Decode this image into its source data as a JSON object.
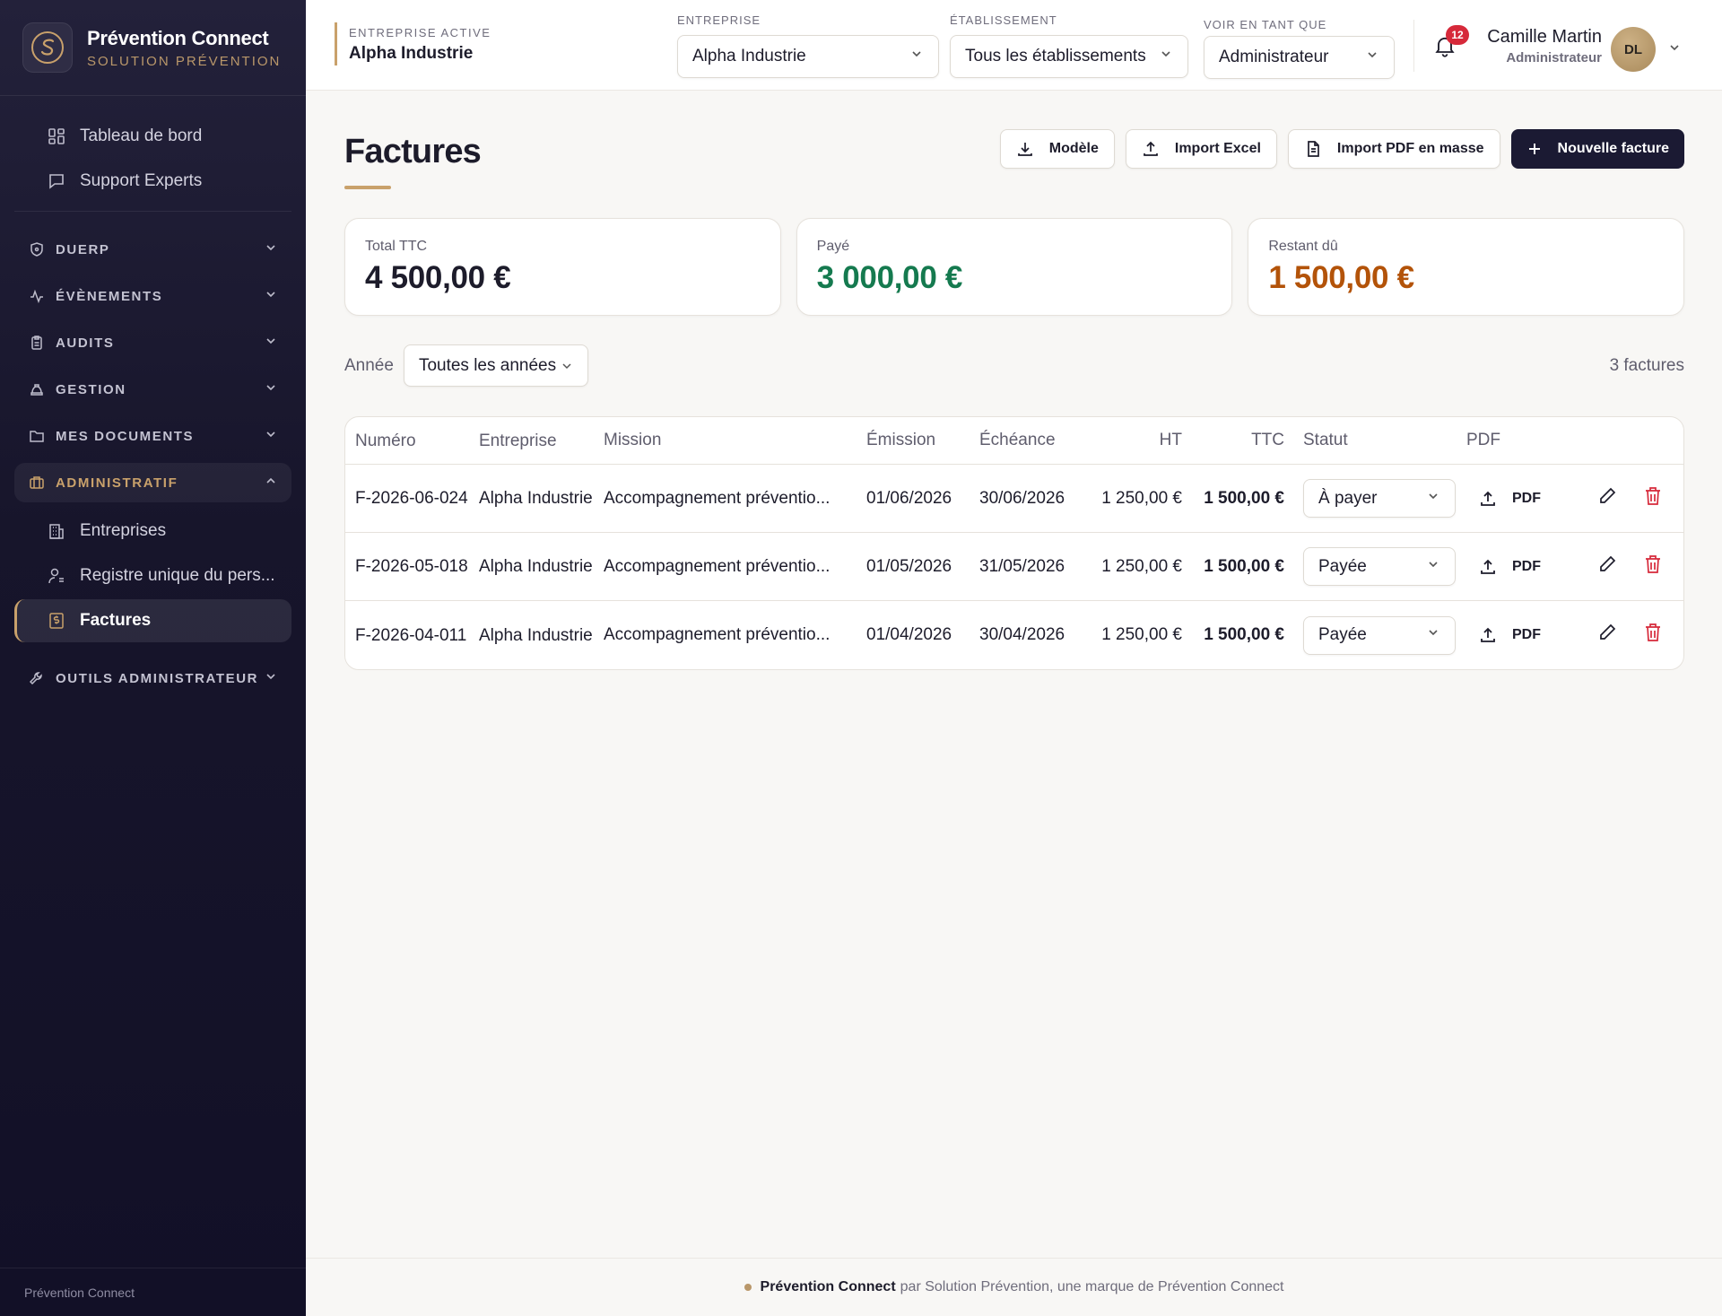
{
  "brand": {
    "name": "Prévention Connect",
    "tagline": "SOLUTION PRÉVENTION",
    "footer": "Prévention Connect"
  },
  "nav": {
    "top_items": [
      {
        "label": "Tableau de bord",
        "icon": "dashboard-icon"
      },
      {
        "label": "Support Experts",
        "icon": "chat-icon"
      }
    ],
    "sections": [
      {
        "label": "DUERP",
        "icon": "shield-icon"
      },
      {
        "label": "ÉVÈNEMENTS",
        "icon": "activity-icon"
      },
      {
        "label": "AUDITS",
        "icon": "clipboard-icon"
      },
      {
        "label": "GESTION",
        "icon": "hardhat-icon"
      },
      {
        "label": "MES DOCUMENTS",
        "icon": "folder-icon"
      },
      {
        "label": "ADMINISTRATIF",
        "icon": "briefcase-icon"
      },
      {
        "label": "OUTILS ADMINISTRATEUR",
        "icon": "wrench-icon"
      }
    ],
    "admin_items": [
      {
        "label": "Entreprises",
        "icon": "building-icon"
      },
      {
        "label": "Registre unique du pers...",
        "icon": "user-list-icon"
      },
      {
        "label": "Factures",
        "icon": "invoice-icon"
      }
    ]
  },
  "header": {
    "active_company_label": "ENTREPRISE ACTIVE",
    "active_company": "Alpha Industrie",
    "company_label": "ENTREPRISE",
    "company_value": "Alpha Industrie",
    "site_label": "ÉTABLISSEMENT",
    "site_value": "Tous les établissements",
    "view_as_label": "VOIR EN TANT QUE",
    "view_as_value": "Administrateur",
    "notifications": "12",
    "user_name": "Camille Martin",
    "user_role": "Administrateur",
    "avatar_initials": "DL"
  },
  "page": {
    "title": "Factures",
    "actions": {
      "template": "Modèle",
      "import_excel": "Import Excel",
      "import_pdf": "Import PDF en masse",
      "new_invoice": "Nouvelle facture"
    },
    "summary": {
      "total_label": "Total TTC",
      "total_value": "4 500,00 €",
      "paid_label": "Payé",
      "paid_value": "3 000,00 €",
      "due_label": "Restant dû",
      "due_value": "1 500,00 €"
    },
    "filter": {
      "label": "Année",
      "value": "Toutes les années"
    },
    "count": "3 factures"
  },
  "table": {
    "columns": [
      "Numéro",
      "Entreprise",
      "Mission",
      "Émission",
      "Échéance",
      "HT",
      "TTC",
      "Statut",
      "PDF"
    ],
    "rows": [
      {
        "numero": "F-2026-06-024",
        "entreprise": "Alpha Industrie",
        "mission": "Accompagnement préventio...",
        "emission": "01/06/2026",
        "echeance": "30/06/2026",
        "ht": "1 250,00 €",
        "ttc": "1 500,00 €",
        "statut": "À payer",
        "pdf": "PDF"
      },
      {
        "numero": "F-2026-05-018",
        "entreprise": "Alpha Industrie",
        "mission": "Accompagnement préventio...",
        "emission": "01/05/2026",
        "echeance": "31/05/2026",
        "ht": "1 250,00 €",
        "ttc": "1 500,00 €",
        "statut": "Payée",
        "pdf": "PDF"
      },
      {
        "numero": "F-2026-04-011",
        "entreprise": "Alpha Industrie",
        "mission": "Accompagnement préventio...",
        "emission": "01/04/2026",
        "echeance": "30/04/2026",
        "ht": "1 250,00 €",
        "ttc": "1 500,00 €",
        "statut": "Payée",
        "pdf": "PDF"
      }
    ]
  },
  "footer": {
    "brand": "Prévention Connect",
    "text": "par Solution Prévention, une marque de Prévention Connect"
  },
  "colors": {
    "accent": "#c9a16b",
    "paid": "#157a4f",
    "due": "#b35309",
    "primary": "#1b1a33",
    "danger": "#d6293a"
  }
}
